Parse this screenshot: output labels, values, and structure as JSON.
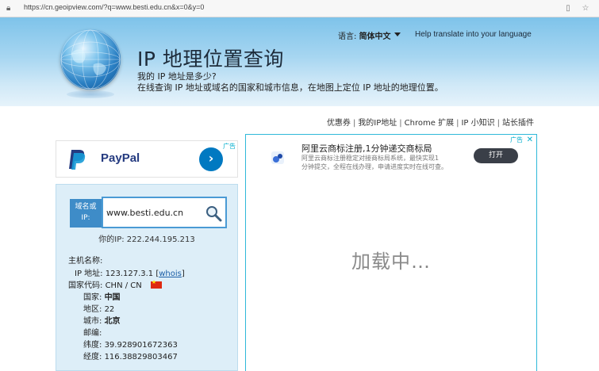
{
  "browser": {
    "url": "https://cn.geoipview.com/?q=www.besti.edu.cn&x=0&y=0"
  },
  "header": {
    "title": "IP 地理位置查询",
    "subtitle1": "我的 IP 地址是多少?",
    "subtitle2": "在线查询 IP 地址或域名的国家和城市信息，在地图上定位 IP 地址的地理位置。",
    "lang_label": "语言:",
    "lang_value": "简体中文",
    "help_translate": "Help translate into your language"
  },
  "toplinks": [
    "优惠券",
    "我的IP地址",
    "Chrome 扩展",
    "IP 小知识",
    "站长插件"
  ],
  "paypal_ad": {
    "brand": "PayPal",
    "adchoice": "广告"
  },
  "query": {
    "label_line1": "域名或",
    "label_line2": "IP:",
    "value": "www.besti.edu.cn",
    "my_ip": "你的IP: 222.244.195.213"
  },
  "info": {
    "hostname_label": "主机名称:",
    "ip_label": "IP 地址:",
    "ip_value": "123.127.3.1",
    "whois": "whois",
    "country_code_label": "国家代码:",
    "country_code_value": "CHN / CN",
    "country_label": "国家:",
    "country_value": "中国",
    "region_label": "地区:",
    "region_value": "22",
    "city_label": "城市:",
    "city_value": "北京",
    "postal_label": "邮编:",
    "postal_value": "",
    "lat_label": "纬度:",
    "lat_value": "39.928901672363",
    "lon_label": "经度:",
    "lon_value": "116.38829803467"
  },
  "aliyun_ad": {
    "title": "阿里云商标注册,1分钟递交商标局",
    "desc1": "阿里云商标注册稳定对接商标局系统，最快实现1",
    "desc2": "分钟提交，全程在线办理，申请进度实时在线可查。",
    "button": "打开",
    "adchoice": "广告"
  },
  "loading_text": "加载中…"
}
